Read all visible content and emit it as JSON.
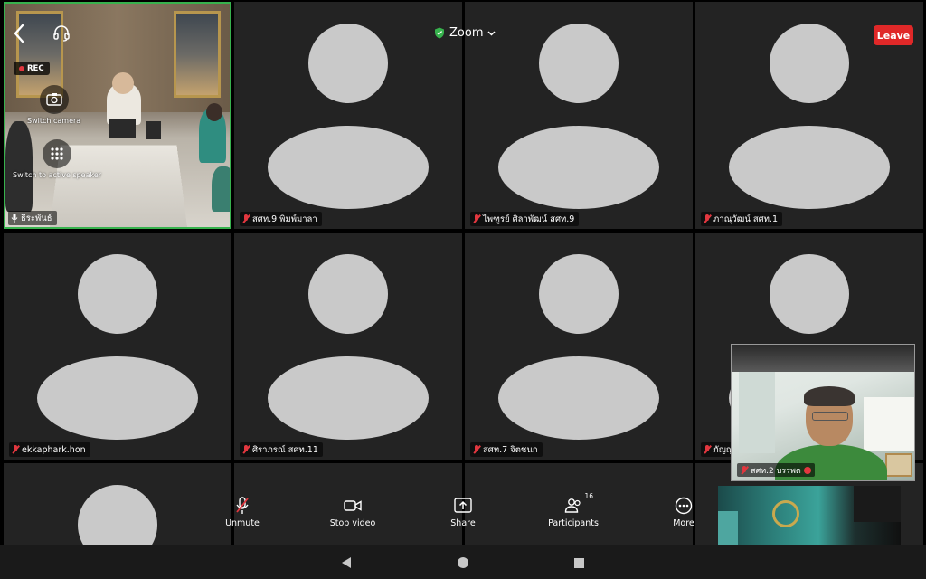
{
  "topbar": {
    "title": "Zoom",
    "leave_label": "Leave",
    "secure_color": "#37b24d",
    "leave_color": "#e02828"
  },
  "active_tile": {
    "rec_label": "REC",
    "switch_camera_label": "Switch camera",
    "switch_speaker_label": "Switch to active speaker",
    "name": "ธีระพันธ์"
  },
  "participants": [
    {
      "name": "สศท.9 พิมพ์มาลา"
    },
    {
      "name": "ไพฑูรย์ ศิลาพัฒน์ สศท.9"
    },
    {
      "name": "ภาณุวัฒน์ สศท.1"
    },
    {
      "name": "ekkaphark.hon"
    },
    {
      "name": "ศิราภรณ์ สศท.11"
    },
    {
      "name": "สศท.7 จิตชนก"
    },
    {
      "name": "กัญญ"
    }
  ],
  "self_view": {
    "name": "สศท.2 บรรพต"
  },
  "controls": {
    "unmute": "Unmute",
    "stop_video": "Stop video",
    "share": "Share",
    "participants": "Participants",
    "participants_count": "16",
    "more": "More"
  }
}
